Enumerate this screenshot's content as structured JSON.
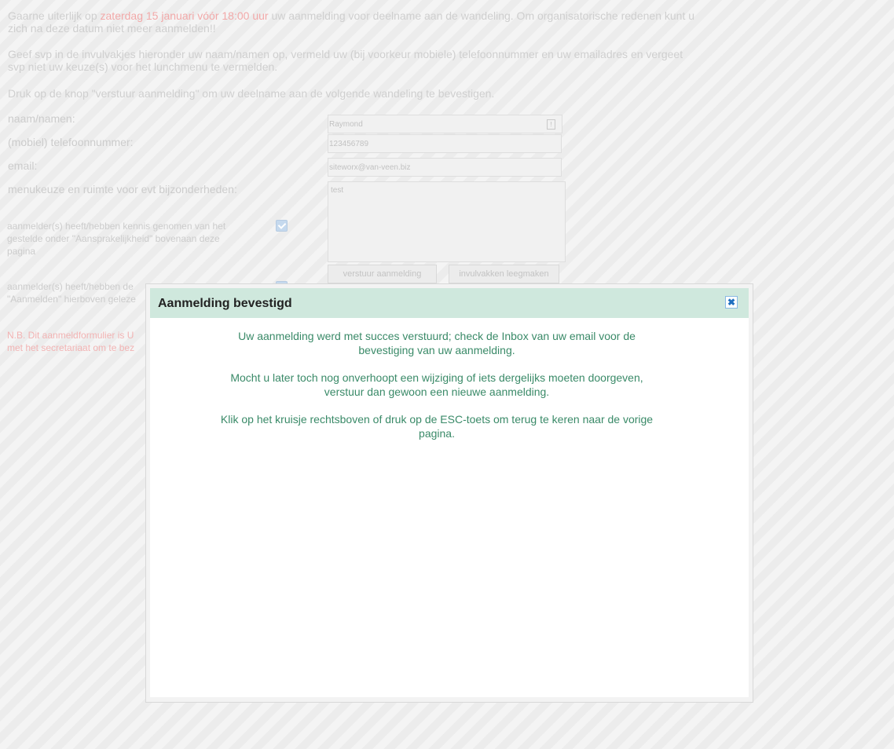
{
  "intro": {
    "p1_before": "Gaarne uiterlijk op ",
    "p1_highlight": "zaterdag 15 januari vóór 18:00 uur",
    "p1_after": " uw aanmelding voor deelname aan de wandeling. Om organisatorische redenen kunt u zich na deze datum niet meer aanmelden!!",
    "p2": "Geef svp in de invulvakjes hieronder uw naam/namen op, vermeld uw (bij voorkeur mobiele) telefoonnummer en uw emailadres en vergeet svp niet uw keuze(s) voor het lunchmenu te vermelden.",
    "p3": "Druk op de knop \"verstuur aanmelding\" om uw deelname aan de volgende wandeling te bevestigen."
  },
  "form": {
    "name_label": "naam/namen:",
    "name_value": "Raymond",
    "phone_label": "(mobiel) telefoonnummer:",
    "phone_value": "123456789",
    "email_label": "email:",
    "email_value": "siteworx@van-veen.biz",
    "menu_label": "menukeuze en ruimte voor evt bijzonderheden:",
    "menu_value": "test",
    "consent1": "aanmelder(s) heeft/hebben kennis genomen van het gestelde onder \"Aansprakelijkheid\" bovenaan deze pagina",
    "consent2_line1": "aanmelder(s) heeft/hebben de",
    "consent2_line2": "\"Aanmelden\" hierboven geleze",
    "submit_label": "verstuur aanmelding",
    "clear_label": "invulvakken leegmaken",
    "nb_line1": "N.B. Dit aanmeldformulier is U",
    "nb_line2": "met het secretariaat om te bez"
  },
  "dialog": {
    "title": "Aanmelding bevestigd",
    "close_glyph": "✖",
    "p1": "Uw aanmelding werd met succes verstuurd; check de Inbox van uw email voor de bevestiging van uw aanmelding.",
    "p2": "Mocht u later toch nog onverhoopt een wijziging of iets dergelijks moeten doorgeven, verstuur dan gewoon een nieuwe aanmelding.",
    "p3": "Klik op het kruisje rechtsboven of druk op de ESC-toets om terug te keren naar de vorige pagina."
  }
}
